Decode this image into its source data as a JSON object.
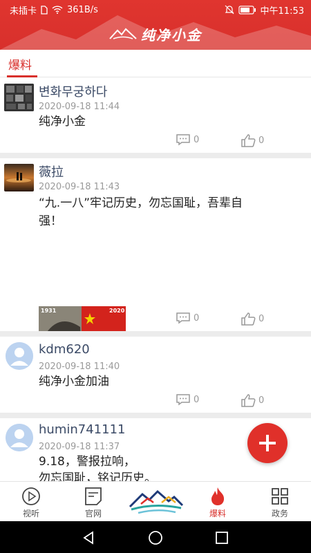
{
  "status_bar": {
    "carrier": "未插卡",
    "speed": "361B/s",
    "time": "中午11:53"
  },
  "header": {
    "app_title": "纯净小金",
    "brand_color": "#d8302c"
  },
  "tabs": {
    "active_label": "爆料"
  },
  "posts": [
    {
      "username": "변화무궁하다",
      "time": "2020-09-18 11:44",
      "content": "纯净小金",
      "comments": "0",
      "likes": "0"
    },
    {
      "username": "薇拉",
      "time": "2020-09-18 11:43",
      "content_line1": "“九.一八”牢记历史，勿忘国耻，吾辈自",
      "content_line2": "强！",
      "image_texts": [
        "1931",
        "2020"
      ],
      "comments": "0",
      "likes": "0"
    },
    {
      "username": "kdm620",
      "time": "2020-09-18 11:40",
      "content": "纯净小金加油",
      "comments": "0",
      "likes": "0"
    },
    {
      "username": "humin741111",
      "time": "2020-09-18 11:37",
      "content_line1": "9.18，警报拉响，",
      "content_line2": "勿忘国耻，铭记历史。"
    }
  ],
  "bottom_nav": {
    "items": [
      {
        "label": "视听",
        "icon": "play-circle-icon"
      },
      {
        "label": "官网",
        "icon": "document-icon"
      },
      {
        "label": "",
        "icon": "mountain-logo-icon"
      },
      {
        "label": "爆料",
        "icon": "flame-icon"
      },
      {
        "label": "政务",
        "icon": "grid-icon"
      }
    ]
  }
}
